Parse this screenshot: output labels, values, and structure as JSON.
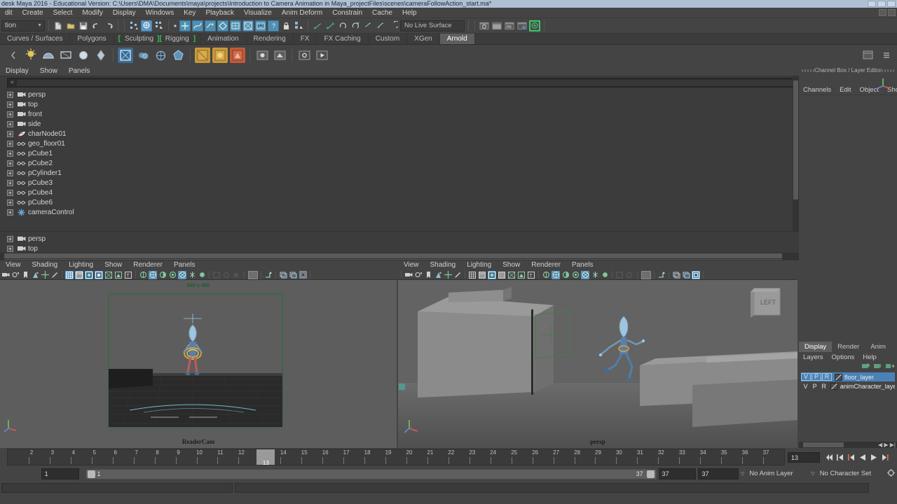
{
  "window": {
    "title": "desk Maya 2016 - Educational Version: C:\\Users\\DMA\\Documents\\maya\\projects\\Introduction to Camera Animation in Maya_projectFiles\\scenes\\cameraFollowAction_start.ma*"
  },
  "menubar": {
    "items": [
      "dit",
      "Create",
      "Select",
      "Modify",
      "Display",
      "Windows",
      "Key",
      "Playback",
      "Visualize",
      "Anim Deform",
      "Constrain",
      "Cache",
      "Help"
    ]
  },
  "statusline": {
    "mode_selector": "tion",
    "live_surface": "No Live Surface",
    "icons": [
      "new-scene-icon",
      "open-scene-icon",
      "save-scene-icon",
      "undo-icon",
      "redo-icon",
      "select-by-hierarchy-icon",
      "select-by-object-icon",
      "select-by-component-icon",
      "snap-to-grid-icon",
      "snap-to-curve-icon",
      "snap-to-point-icon",
      "snap-to-plane-icon",
      "snap-to-view-plane-icon",
      "snap-to-uv-icon",
      "make-live-icon",
      "lock-icon",
      "render-current-frame-icon",
      "ipr-render-icon",
      "render-settings-icon",
      "hypershade-icon",
      "render-view-icon",
      "render-sequence-icon",
      "arnold-render-icon"
    ]
  },
  "shelf": {
    "tabs": [
      {
        "label": "Curves / Surfaces",
        "active": false
      },
      {
        "label": "Polygons",
        "active": false
      },
      {
        "label": "Sculpting",
        "active": false,
        "bracket": true
      },
      {
        "label": "Rigging",
        "active": false,
        "bracket": true
      },
      {
        "label": "Animation",
        "active": false
      },
      {
        "label": "Rendering",
        "active": false
      },
      {
        "label": "FX",
        "active": false
      },
      {
        "label": "FX Caching",
        "active": false
      },
      {
        "label": "Custom",
        "active": false
      },
      {
        "label": "XGen",
        "active": false
      },
      {
        "label": "Arnold",
        "active": true
      }
    ]
  },
  "outliner": {
    "menu": [
      "Display",
      "Show",
      "Panels"
    ],
    "search_placeholder": "",
    "items": [
      {
        "label": "persp",
        "icon": "camera-icon"
      },
      {
        "label": "top",
        "icon": "camera-icon"
      },
      {
        "label": "front",
        "icon": "camera-icon"
      },
      {
        "label": "side",
        "icon": "camera-icon"
      },
      {
        "label": "charNode01",
        "icon": "character-set-icon"
      },
      {
        "label": "geo_floor01",
        "icon": "mesh-icon"
      },
      {
        "label": "pCube1",
        "icon": "mesh-icon"
      },
      {
        "label": "pCube2",
        "icon": "mesh-icon"
      },
      {
        "label": "pCylinder1",
        "icon": "mesh-icon"
      },
      {
        "label": "pCube3",
        "icon": "mesh-icon"
      },
      {
        "label": "pCube4",
        "icon": "mesh-icon"
      },
      {
        "label": "pCube6",
        "icon": "mesh-icon"
      },
      {
        "label": "cameraControl",
        "icon": "transform-icon"
      }
    ]
  },
  "outliner2": {
    "items": [
      {
        "label": "persp",
        "icon": "camera-icon"
      },
      {
        "label": "top",
        "icon": "camera-icon"
      }
    ]
  },
  "viewport_left": {
    "menu": [
      "View",
      "Shading",
      "Lighting",
      "Show",
      "Renderer",
      "Panels"
    ],
    "resolution_label": "640 x 480",
    "camera_label": "ReaderCam"
  },
  "viewport_right": {
    "menu": [
      "View",
      "Shading",
      "Lighting",
      "Show",
      "Renderer",
      "Panels"
    ],
    "camera_label": "persp",
    "view_cube_label": "LEFT"
  },
  "channelbox": {
    "title": "Channel Box / Layer Editor",
    "tabs": [
      "Channels",
      "Edit",
      "Object",
      "Show"
    ]
  },
  "layer_editor": {
    "tabs": [
      {
        "label": "Display",
        "active": true
      },
      {
        "label": "Render",
        "active": false
      },
      {
        "label": "Anim",
        "active": false
      }
    ],
    "menu": [
      "Layers",
      "Options",
      "Help"
    ],
    "layers": [
      {
        "v": "V",
        "p": "P",
        "r": "R",
        "name": "floor_layer",
        "selected": true
      },
      {
        "v": "V",
        "p": "P",
        "r": "R",
        "name": "animCharacter_layer",
        "selected": false
      }
    ]
  },
  "timeslider": {
    "ticks": [
      2,
      3,
      4,
      5,
      6,
      7,
      8,
      9,
      10,
      11,
      12,
      13,
      14,
      15,
      16,
      17,
      18,
      19,
      20,
      21,
      22,
      23,
      24,
      25,
      26,
      27,
      28,
      29,
      30,
      31,
      32,
      33,
      34,
      35,
      36,
      37
    ],
    "current_frame": "13",
    "current_frame_field": "13",
    "playback_buttons": [
      "go-to-start-icon",
      "step-back-key-icon",
      "step-back-frame-icon",
      "play-backwards-icon",
      "play-forwards-icon",
      "go-to-end-icon"
    ]
  },
  "rangeslider": {
    "anim_start": "1",
    "range_start": "1",
    "range_end": "37",
    "playback_end": "37",
    "anim_end": "37",
    "anim_layer": "No Anim Layer",
    "character_set": "No Character Set"
  },
  "helpline": {
    "text": ""
  },
  "colors": {
    "accent_blue": "#5c97c4",
    "shelf_active": "#5e5e5e",
    "layer_selected": "#4a82b8",
    "gate_green": "#2d6a3e",
    "panel_bg": "#444444",
    "viewport_bg": "#5a5a5a"
  }
}
